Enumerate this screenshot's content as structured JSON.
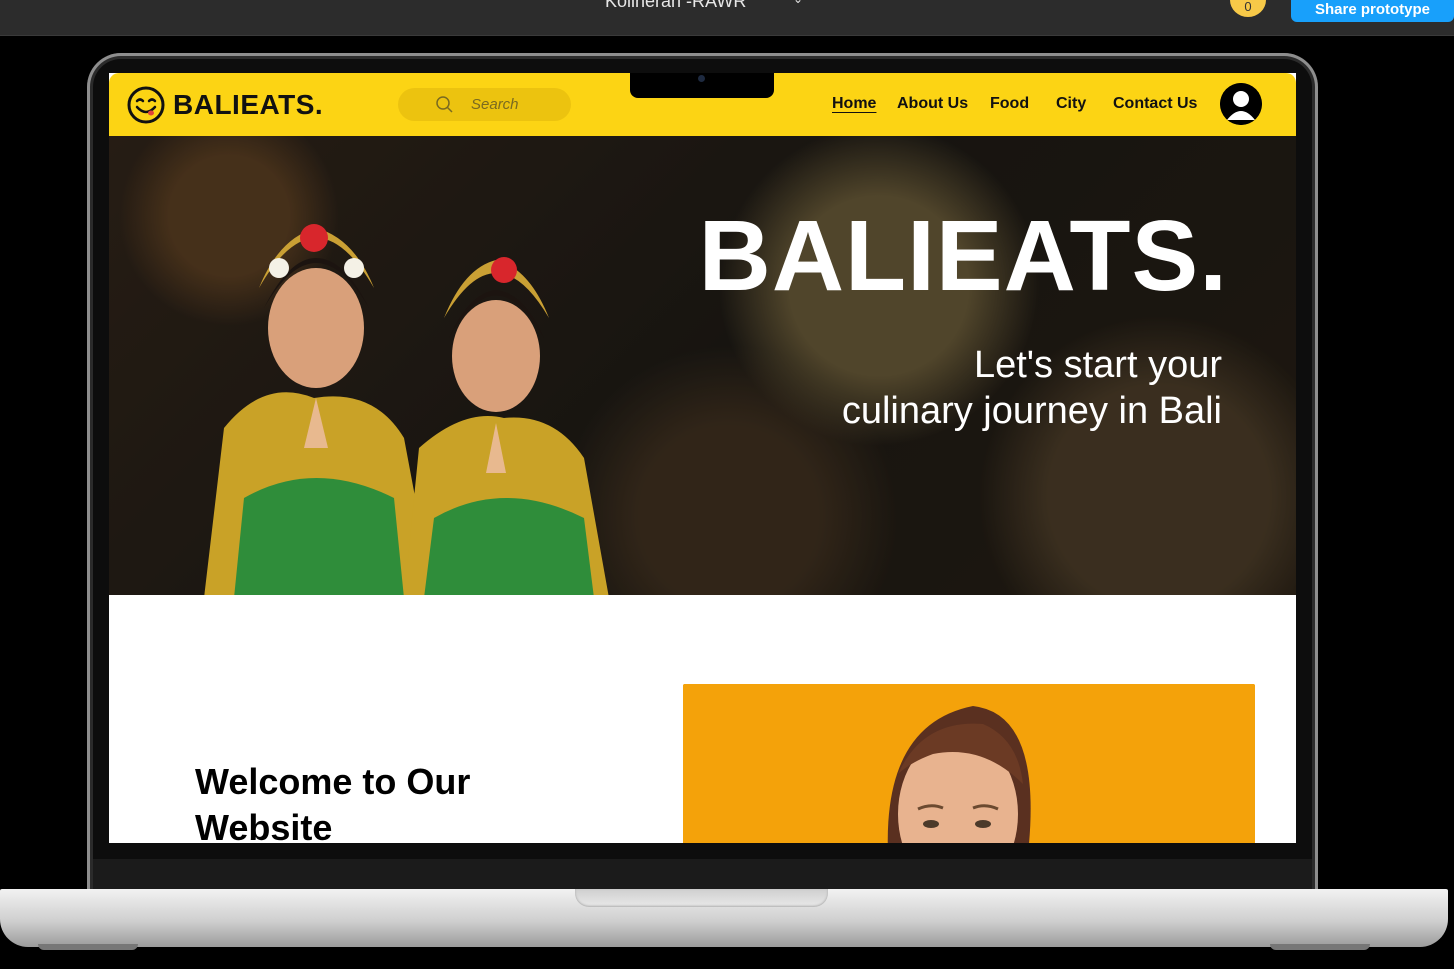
{
  "prototype_bar": {
    "file_title": "Kolineran -RAWR",
    "viewer_count": "0",
    "share_label": "Share prototype"
  },
  "site": {
    "brand": "BALIEATS.",
    "search": {
      "placeholder": "Search"
    },
    "nav": [
      {
        "label": "Home",
        "active": true
      },
      {
        "label": "About Us",
        "active": false
      },
      {
        "label": "Food",
        "active": false
      },
      {
        "label": "City",
        "active": false
      },
      {
        "label": "Contact Us",
        "active": false
      }
    ],
    "hero": {
      "title": "BALIEATS.",
      "subtitle_line1": "Let's start your",
      "subtitle_line2": "culinary journey in Bali"
    },
    "welcome": {
      "line1": "Welcome to Our",
      "line2": "Website"
    }
  },
  "colors": {
    "brand_yellow": "#fcd414",
    "search_bg": "#ecc30f",
    "figma_blue": "#18a0fb",
    "card_orange": "#f4a20a"
  },
  "icons": [
    "search-icon",
    "smile-logo-icon",
    "user-avatar-icon",
    "chevron-down-icon"
  ]
}
